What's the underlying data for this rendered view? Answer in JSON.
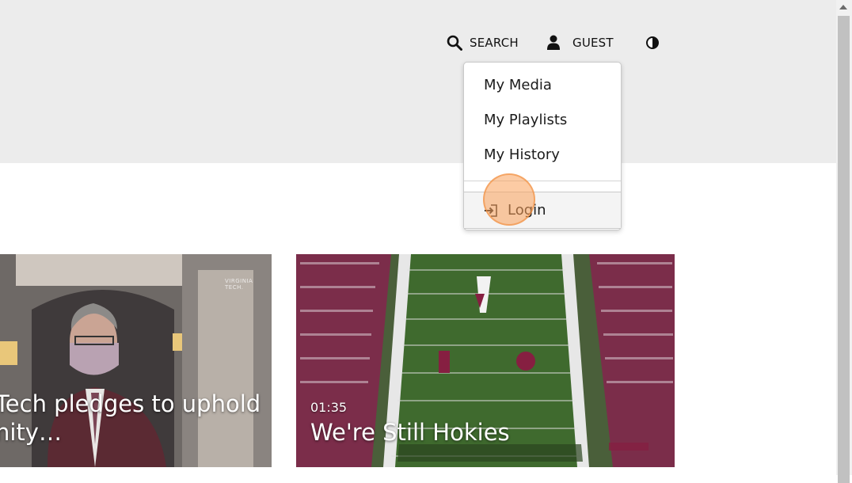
{
  "header": {
    "search_label": "SEARCH",
    "user_label": "GUEST",
    "icons": {
      "search": "search-icon",
      "user": "user-icon",
      "contrast": "contrast-icon"
    }
  },
  "user_menu": {
    "items": [
      {
        "label": "My Media"
      },
      {
        "label": "My Playlists"
      },
      {
        "label": "My History"
      }
    ],
    "login_label": "Login",
    "login_icon": "login-icon"
  },
  "cards": [
    {
      "title_line1": "Tech pledges to uphold",
      "title_line2": "nity…",
      "watermark": "VIRGINIA TECH."
    },
    {
      "duration": "01:35",
      "title": "We're Still Hokies"
    }
  ],
  "colors": {
    "header_bg": "#ececec",
    "click_highlight": "#faa05a",
    "field_green": "#4f6b3a",
    "maroon": "#861f41"
  }
}
